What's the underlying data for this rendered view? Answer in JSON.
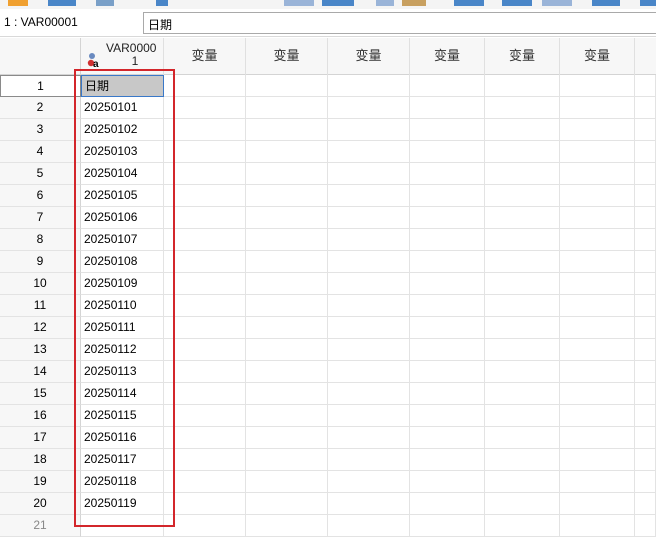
{
  "editbar": {
    "cell_ref": "1 : VAR00001",
    "cell_value": "日期"
  },
  "grid": {
    "first_column_header": "VAR00001",
    "empty_column_label": "变量",
    "empty_columns": [
      "变量",
      "变量",
      "变量",
      "变量",
      "变量",
      "变量"
    ],
    "rows": [
      {
        "num": "1",
        "value": "日期"
      },
      {
        "num": "2",
        "value": "20250101"
      },
      {
        "num": "3",
        "value": "20250102"
      },
      {
        "num": "4",
        "value": "20250103"
      },
      {
        "num": "5",
        "value": "20250104"
      },
      {
        "num": "6",
        "value": "20250105"
      },
      {
        "num": "7",
        "value": "20250106"
      },
      {
        "num": "8",
        "value": "20250107"
      },
      {
        "num": "9",
        "value": "20250108"
      },
      {
        "num": "10",
        "value": "20250109"
      },
      {
        "num": "11",
        "value": "20250110"
      },
      {
        "num": "12",
        "value": "20250111"
      },
      {
        "num": "13",
        "value": "20250112"
      },
      {
        "num": "14",
        "value": "20250113"
      },
      {
        "num": "15",
        "value": "20250114"
      },
      {
        "num": "16",
        "value": "20250115"
      },
      {
        "num": "17",
        "value": "20250116"
      },
      {
        "num": "18",
        "value": "20250117"
      },
      {
        "num": "19",
        "value": "20250118"
      },
      {
        "num": "20",
        "value": "20250119"
      },
      {
        "num": "21",
        "value": ""
      }
    ]
  },
  "colors": {
    "highlight_border": "#d3262b",
    "active_cell_bg": "#c8c8c8",
    "header_bg": "#f7f7f7"
  },
  "icons": {
    "variable_type": "string-variable-icon"
  }
}
